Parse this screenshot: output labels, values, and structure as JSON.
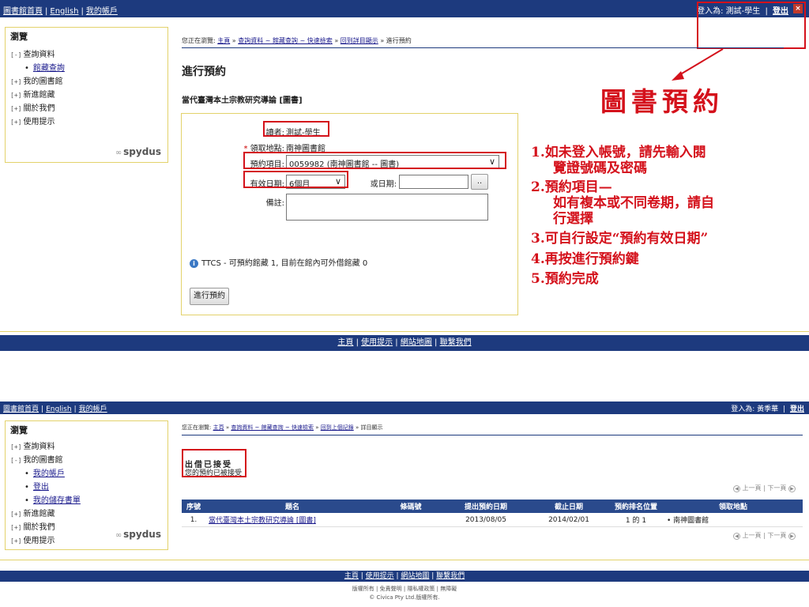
{
  "panel1": {
    "topbar": {
      "links": [
        "圖書館首頁",
        "English",
        "我的帳戶"
      ],
      "login_text": "登入為: 測試-學生",
      "logout_label": "登出"
    },
    "sidebar": {
      "heading": "瀏覽",
      "items": [
        {
          "pm": "[-]",
          "label": "查詢資料"
        },
        {
          "sub": true,
          "label": "館藏查詢"
        },
        {
          "pm": "[+]",
          "label": "我的圖書館"
        },
        {
          "pm": "[+]",
          "label": "新進館藏"
        },
        {
          "pm": "[+]",
          "label": "關於我們"
        },
        {
          "pm": "[+]",
          "label": "使用提示"
        }
      ],
      "logo": "spydus"
    },
    "breadcrumb": {
      "prefix": "您正在瀏覽:",
      "links": [
        "主頁",
        "查詢資料 ~ 館藏查詢 ~ 快速檢索",
        "回到詳目顯示"
      ],
      "current": "» 進行預約"
    },
    "page_title": "進行預約",
    "book_title": "當代臺灣本土宗教研究導論 [圖書]",
    "form": {
      "reader_label": "讀者:",
      "reader_value": "測試-學生",
      "pickup_label": "領取地點:",
      "pickup_value": "南神圖書館",
      "item_label": "預約項目:",
      "item_value": "0059982 (南神圖書館 -- 圖書)",
      "valid_label": "有效日期:",
      "valid_value": "6個月",
      "or_date_label": "或日期:",
      "date_button": "..",
      "note_label": "備註:",
      "info_text": "TTCS - 可預約館藏 1, 目前在館內可外借館藏 0",
      "submit_label": "進行預約"
    },
    "annotation": {
      "title": "圖書預約",
      "lines": [
        "1.如未登入帳號，請先輸入閱",
        "覽證號碼及密碼",
        "2.預約項目—",
        "如有複本或不同卷期，請自",
        "行選擇",
        "3.可自行設定“預約有效日期”",
        "4.再按進行預約鍵",
        "5.預約完成"
      ]
    },
    "footer_links": [
      "主頁",
      "使用提示",
      "網站地圖",
      "聯繫我們"
    ]
  },
  "panel2": {
    "topbar": {
      "links": [
        "圖書館首頁",
        "English",
        "我的帳戶"
      ],
      "login_text": "登入為: 黃季華",
      "logout_label": "登出"
    },
    "sidebar": {
      "heading": "瀏覽",
      "items": [
        {
          "pm": "[+]",
          "label": "查詢資料"
        },
        {
          "pm": "[-]",
          "label": "我的圖書館"
        },
        {
          "sub": true,
          "label": "我的帳戶"
        },
        {
          "sub": true,
          "label": "登出"
        },
        {
          "sub": true,
          "label": "我的儲存書單"
        },
        {
          "pm": "[+]",
          "label": "新進館藏"
        },
        {
          "pm": "[+]",
          "label": "關於我們"
        },
        {
          "pm": "[+]",
          "label": "使用提示"
        }
      ],
      "logo": "spydus"
    },
    "breadcrumb": {
      "prefix": "您正在瀏覽:",
      "links": [
        "主頁",
        "查詢資料 ~ 館藏查詢 ~ 快速檢索",
        "回到上個記錄"
      ],
      "current": "» 詳目顯示"
    },
    "accepted_title": "出借已接受",
    "accepted_sub": "您的預約已被接受",
    "pager": "上一頁 | 下一頁",
    "table": {
      "headers": [
        "序號",
        "題名",
        "條碼號",
        "提出預約日期",
        "截止日期",
        "預約排名位置",
        "領取地點"
      ],
      "rows": [
        [
          "1.",
          "當代臺灣本土宗教研究導論 [圖書]",
          "",
          "2013/08/05",
          "2014/02/01",
          "1 的 1",
          "• 南神圖書館"
        ]
      ]
    },
    "footer_links": [
      "主頁",
      "使用提示",
      "網站地圖",
      "聯繫我們"
    ],
    "footer_small": "版權所有 | 免責聲明 | 隱私權政策 | 無障礙",
    "copyright": "© Civica Pty Ltd.版權所有."
  }
}
